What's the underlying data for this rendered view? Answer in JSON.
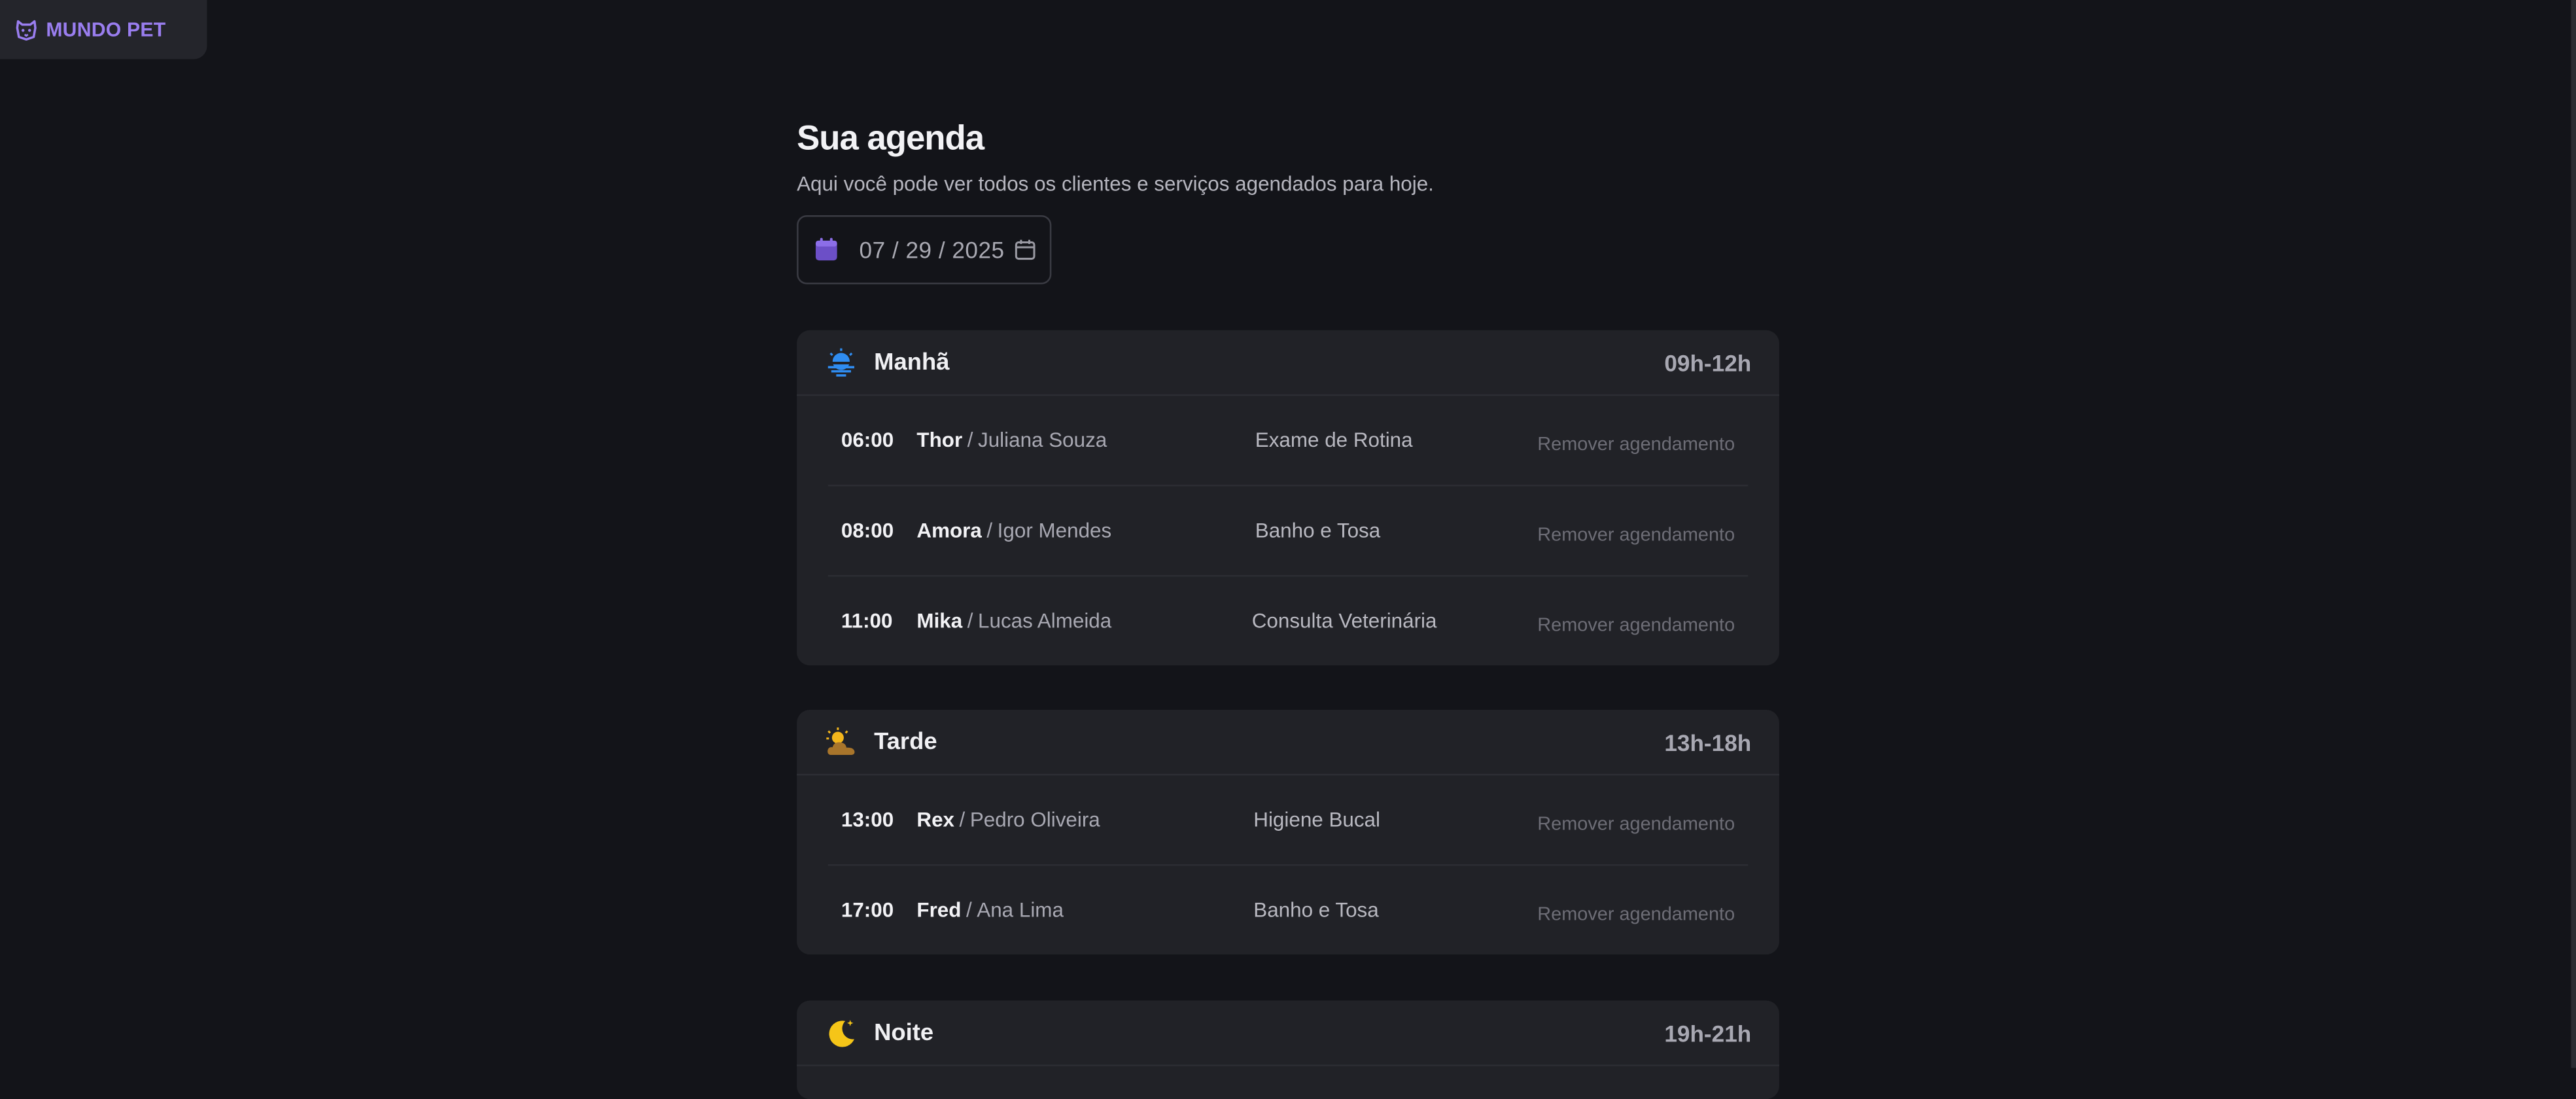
{
  "brand": {
    "name": "MUNDO PET",
    "icon": "dog-icon",
    "color": "#9a7ef0"
  },
  "header": {
    "title": "Sua agenda",
    "subtitle": "Aqui você pode ver todos os clientes e serviços agendados para hoje."
  },
  "date_filter": {
    "value": "07 / 29 / 2025",
    "icon": "calendar-icon",
    "picker_icon": "calendar-outline-icon"
  },
  "periods": [
    {
      "name": "Manhã",
      "range": "09h-12h",
      "icon": "sunrise-icon",
      "appointments": [
        {
          "time": "06:00",
          "pet": "Thor",
          "owner": "Juliana Souza",
          "service": "Exame de Rotina",
          "action": "Remover agendamento"
        },
        {
          "time": "08:00",
          "pet": "Amora",
          "owner": "Igor Mendes",
          "service": "Banho e Tosa",
          "action": "Remover agendamento"
        },
        {
          "time": "11:00",
          "pet": "Mika",
          "owner": "Lucas Almeida",
          "service": "Consulta Veterinária",
          "action": "Remover agendamento"
        }
      ]
    },
    {
      "name": "Tarde",
      "range": "13h-18h",
      "icon": "sun-behind-cloud-icon",
      "appointments": [
        {
          "time": "13:00",
          "pet": "Rex",
          "owner": "Pedro Oliveira",
          "service": "Higiene Bucal",
          "action": "Remover agendamento"
        },
        {
          "time": "17:00",
          "pet": "Fred",
          "owner": "Ana Lima",
          "service": "Banho e Tosa",
          "action": "Remover agendamento"
        }
      ]
    },
    {
      "name": "Noite",
      "range": "19h-21h",
      "icon": "moon-icon",
      "appointments": []
    }
  ],
  "separator": "/"
}
